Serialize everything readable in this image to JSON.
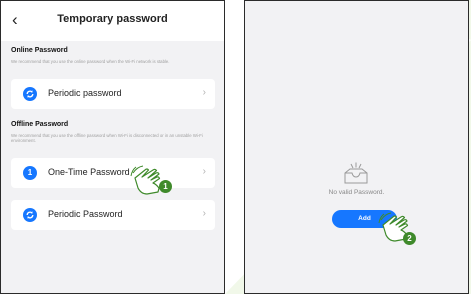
{
  "left_screen": {
    "back_icon": "chevron-left-icon",
    "title": "Temporary password",
    "online": {
      "title": "Online Password",
      "desc": "We recommend that you use the online password when the Wi-Fi network is stable.",
      "items": [
        {
          "label": "Periodic password",
          "icon": "refresh-icon"
        }
      ]
    },
    "offline": {
      "title": "Offline Password",
      "desc": "We recommend that you use the offline password when Wi-Fi is disconnected or in an unstable Wi-Fi environment.",
      "items": [
        {
          "label": "One-Time Password",
          "icon_text": "1"
        },
        {
          "label": "Periodic Password",
          "icon": "refresh-icon"
        }
      ]
    },
    "step_badge": "1"
  },
  "right_screen": {
    "empty_icon": "empty-inbox-icon",
    "empty_text": "No valid Password.",
    "add_label": "Add",
    "step_badge": "2"
  },
  "colors": {
    "accent": "#1677ff",
    "step_green": "#3f8a2b",
    "background_triangle": "#f1f8e9"
  }
}
